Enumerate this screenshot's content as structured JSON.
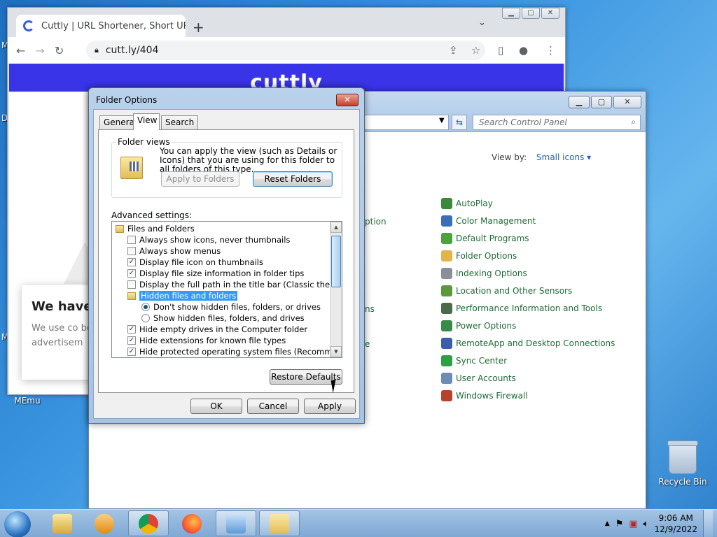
{
  "desktop": {
    "icons": [
      {
        "label": "MEmu"
      },
      {
        "label": "Recycle Bin"
      }
    ],
    "edge_letters": [
      "M",
      "D",
      "M"
    ]
  },
  "chrome": {
    "tab_title": "Cuttly | URL Shortener, Short URL",
    "address": "cutt.ly/404",
    "page_logo": "cuttly",
    "cookie_heading": "We have",
    "cookie_text": "We use co better und advertisem"
  },
  "control_panel": {
    "search_placeholder": "Search Control Panel",
    "view_by_label": "View by:",
    "view_by_value": "Small icons",
    "left_fragments": [
      "ption",
      "ns",
      "e"
    ],
    "items": [
      {
        "label": "AutoPlay",
        "color": "#3b8a3c"
      },
      {
        "label": "Color Management",
        "color": "#3a6fb8"
      },
      {
        "label": "Default Programs",
        "color": "#4aa33b"
      },
      {
        "label": "Folder Options",
        "color": "#e2b44a"
      },
      {
        "label": "Indexing Options",
        "color": "#8a8f98"
      },
      {
        "label": "Location and Other Sensors",
        "color": "#5a9a3a"
      },
      {
        "label": "Performance Information and Tools",
        "color": "#4a6a4a"
      },
      {
        "label": "Power Options",
        "color": "#3a8a4a"
      },
      {
        "label": "RemoteApp and Desktop Connections",
        "color": "#3a5fa8"
      },
      {
        "label": "Sync Center",
        "color": "#2ea043"
      },
      {
        "label": "User Accounts",
        "color": "#6c8cb4"
      },
      {
        "label": "Windows Firewall",
        "color": "#b8412c"
      }
    ]
  },
  "folder_options": {
    "title": "Folder Options",
    "tabs": [
      "General",
      "View",
      "Search"
    ],
    "active_tab": "View",
    "folder_views_label": "Folder views",
    "folder_views_text": "You can apply the view (such as Details or Icons) that you are using for this folder to all folders of this type.",
    "apply_to_folders": "Apply to Folders",
    "reset_folders": "Reset Folders",
    "advanced_label": "Advanced settings:",
    "tree": [
      {
        "type": "folder",
        "label": "Files and Folders"
      },
      {
        "type": "check",
        "checked": false,
        "label": "Always show icons, never thumbnails"
      },
      {
        "type": "check",
        "checked": false,
        "label": "Always show menus"
      },
      {
        "type": "check",
        "checked": true,
        "label": "Display file icon on thumbnails"
      },
      {
        "type": "check",
        "checked": true,
        "label": "Display file size information in folder tips"
      },
      {
        "type": "check",
        "checked": false,
        "label": "Display the full path in the title bar (Classic theme only)"
      },
      {
        "type": "folder-sub",
        "label": "Hidden files and folders"
      },
      {
        "type": "radio",
        "on": true,
        "label": "Don't show hidden files, folders, or drives"
      },
      {
        "type": "radio",
        "on": false,
        "label": "Show hidden files, folders, and drives"
      },
      {
        "type": "check",
        "checked": true,
        "label": "Hide empty drives in the Computer folder"
      },
      {
        "type": "check",
        "checked": true,
        "label": "Hide extensions for known file types"
      },
      {
        "type": "check",
        "checked": true,
        "label": "Hide protected operating system files (Recommended)"
      }
    ],
    "restore_defaults": "Restore Defaults",
    "ok": "OK",
    "cancel": "Cancel",
    "apply": "Apply"
  },
  "taskbar": {
    "time": "9:06 AM",
    "date": "12/9/2022"
  }
}
